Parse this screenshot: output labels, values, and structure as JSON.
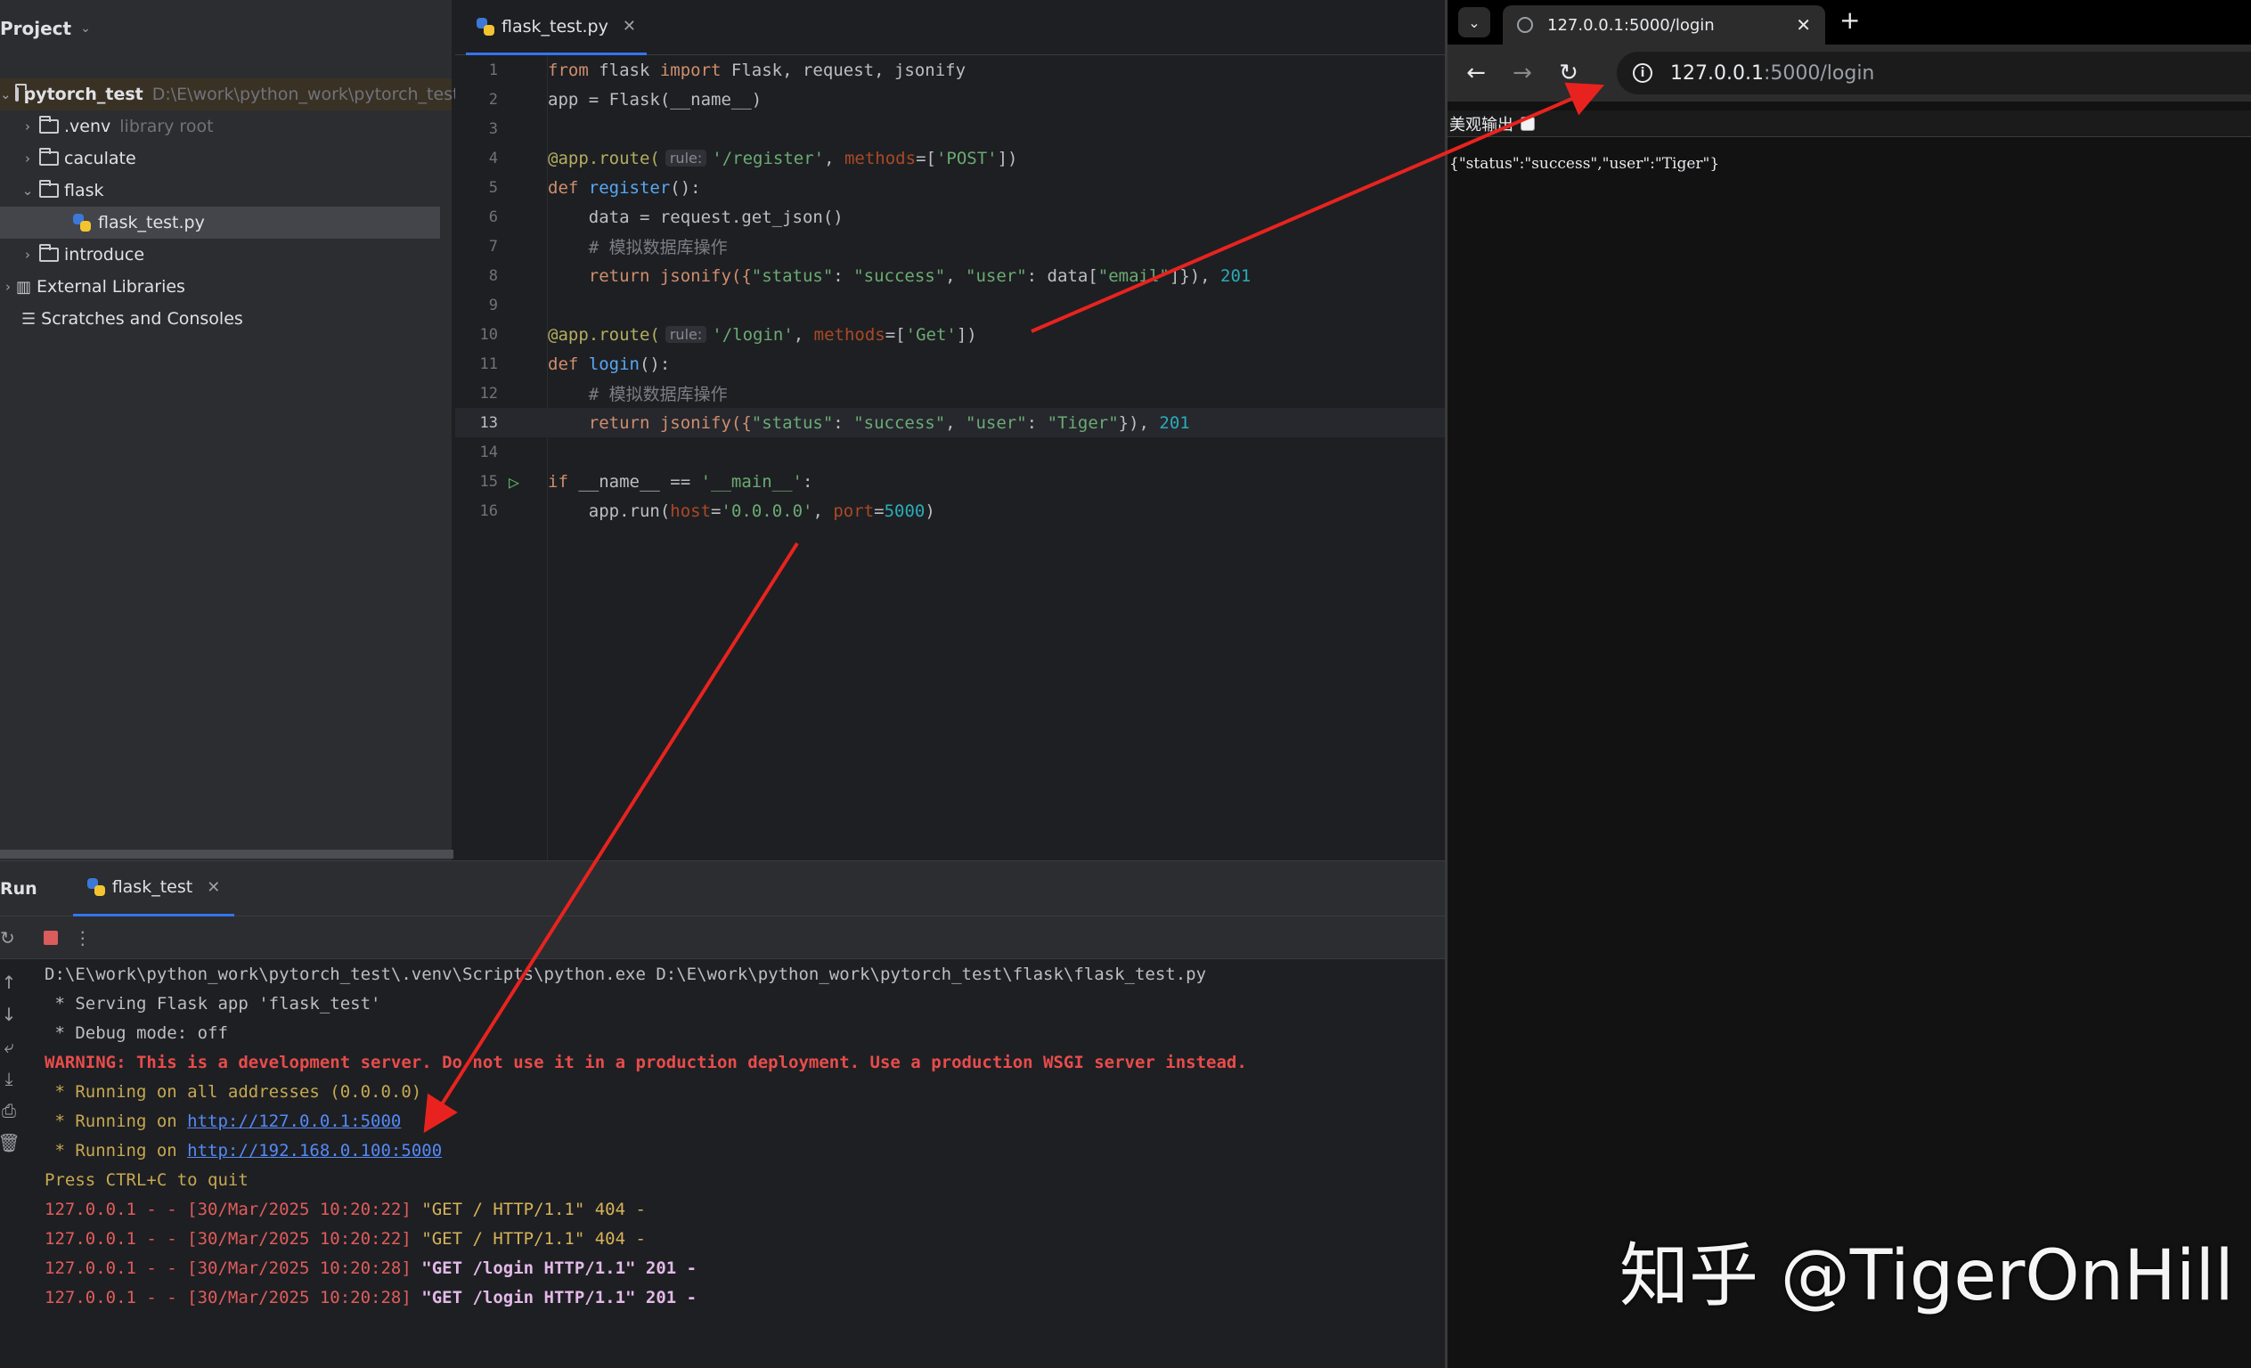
{
  "ide": {
    "project_panel": {
      "title": "Project",
      "tree": [
        {
          "name": "pytorch_test",
          "detail": "D:\\E\\work\\python_work\\pytorch_test"
        },
        {
          "name": ".venv",
          "detail": "library root"
        },
        {
          "name": "caculate"
        },
        {
          "name": "flask"
        },
        {
          "name": "flask_test.py"
        },
        {
          "name": "introduce"
        },
        {
          "name": "External Libraries"
        },
        {
          "name": "Scratches and Consoles"
        }
      ]
    },
    "editor": {
      "tab_label": "flask_test.py",
      "line_numbers": [
        "1",
        "2",
        "3",
        "4",
        "5",
        "6",
        "7",
        "8",
        "9",
        "10",
        "11",
        "12",
        "13",
        "14",
        "15",
        "16"
      ],
      "code": {
        "l1_a": "from",
        "l1_b": " flask ",
        "l1_c": "import",
        "l1_d": " Flask, request, jsonify",
        "l2": "app = Flask(__name__)",
        "l4_a": "@app.route(",
        "l4_hint": "rule:",
        "l4_b": "'/register'",
        "l4_c": ", ",
        "l4_d": "methods",
        "l4_e": "=[",
        "l4_f": "'POST'",
        "l4_g": "])",
        "l5_a": "def ",
        "l5_b": "register",
        "l5_c": "():",
        "l6": "    data = request.get_json()",
        "l7": "    # 模拟数据库操作",
        "l8_a": "    return jsonify({",
        "l8_b": "\"status\"",
        "l8_c": ": ",
        "l8_d": "\"success\"",
        "l8_e": ", ",
        "l8_f": "\"user\"",
        "l8_g": ": data[",
        "l8_h": "\"email\"",
        "l8_i": "]}), ",
        "l8_j": "201",
        "l10_a": "@app.route(",
        "l10_hint": "rule:",
        "l10_b": "'/login'",
        "l10_c": ", ",
        "l10_d": "methods",
        "l10_e": "=[",
        "l10_f": "'Get'",
        "l10_g": "])",
        "l11_a": "def ",
        "l11_b": "login",
        "l11_c": "():",
        "l12": "    # 模拟数据库操作",
        "l13_a": "    return jsonify({",
        "l13_b": "\"status\"",
        "l13_c": ": ",
        "l13_d": "\"success\"",
        "l13_e": ", ",
        "l13_f": "\"user\"",
        "l13_g": ": ",
        "l13_h": "\"Tiger\"",
        "l13_i": "}), ",
        "l13_j": "201",
        "l15_a": "if",
        "l15_b": " __name__ == ",
        "l15_c": "'__main__'",
        "l15_d": ":",
        "l16_a": "    app.run(",
        "l16_b": "host",
        "l16_c": "=",
        "l16_d": "'0.0.0.0'",
        "l16_e": ", ",
        "l16_f": "port",
        "l16_g": "=",
        "l16_h": "5000",
        "l16_i": ")"
      }
    },
    "run_panel": {
      "title": "Run",
      "tab_label": "flask_test",
      "console": {
        "cmd": "D:\\E\\work\\python_work\\pytorch_test\\.venv\\Scripts\\python.exe D:\\E\\work\\python_work\\pytorch_test\\flask\\flask_test.py",
        "serving": " * Serving Flask app 'flask_test'",
        "debug": " * Debug mode: off",
        "warning": "WARNING: This is a development server. Do not use it in a production deployment. Use a production WSGI server instead.",
        "all_addr": " * Running on all addresses (0.0.0.0)",
        "run_prefix": " * Running on ",
        "url1": "http://127.0.0.1:5000",
        "url2": "http://192.168.0.100:5000",
        "quit": "Press CTRL+C to quit",
        "logs": [
          {
            "prefix": "127.0.0.1 - - [30/Mar/2025 10:20:22] ",
            "request": "\"GET / HTTP/1.1\"",
            "suffix": " 404 -"
          },
          {
            "prefix": "127.0.0.1 - - [30/Mar/2025 10:20:22] ",
            "request": "\"GET / HTTP/1.1\"",
            "suffix": " 404 -"
          },
          {
            "prefix": "127.0.0.1 - - [30/Mar/2025 10:20:28] ",
            "request": "\"GET /login HTTP/1.1\"",
            "suffix": " 201 -"
          },
          {
            "prefix": "127.0.0.1 - - [30/Mar/2025 10:20:28] ",
            "request": "\"GET /login HTTP/1.1\"",
            "suffix": " 201 -"
          }
        ]
      }
    }
  },
  "browser": {
    "tab_title": "127.0.0.1:5000/login",
    "address_host": "127.0.0.1",
    "address_path": ":5000/login",
    "pretty_print_label": "美观输出",
    "response_body": "{\"status\":\"success\",\"user\":\"Tiger\"}"
  },
  "watermark": "知乎 @TigerOnHill",
  "colors": {
    "arrow": "#e8231f",
    "accent": "#3574f0"
  }
}
